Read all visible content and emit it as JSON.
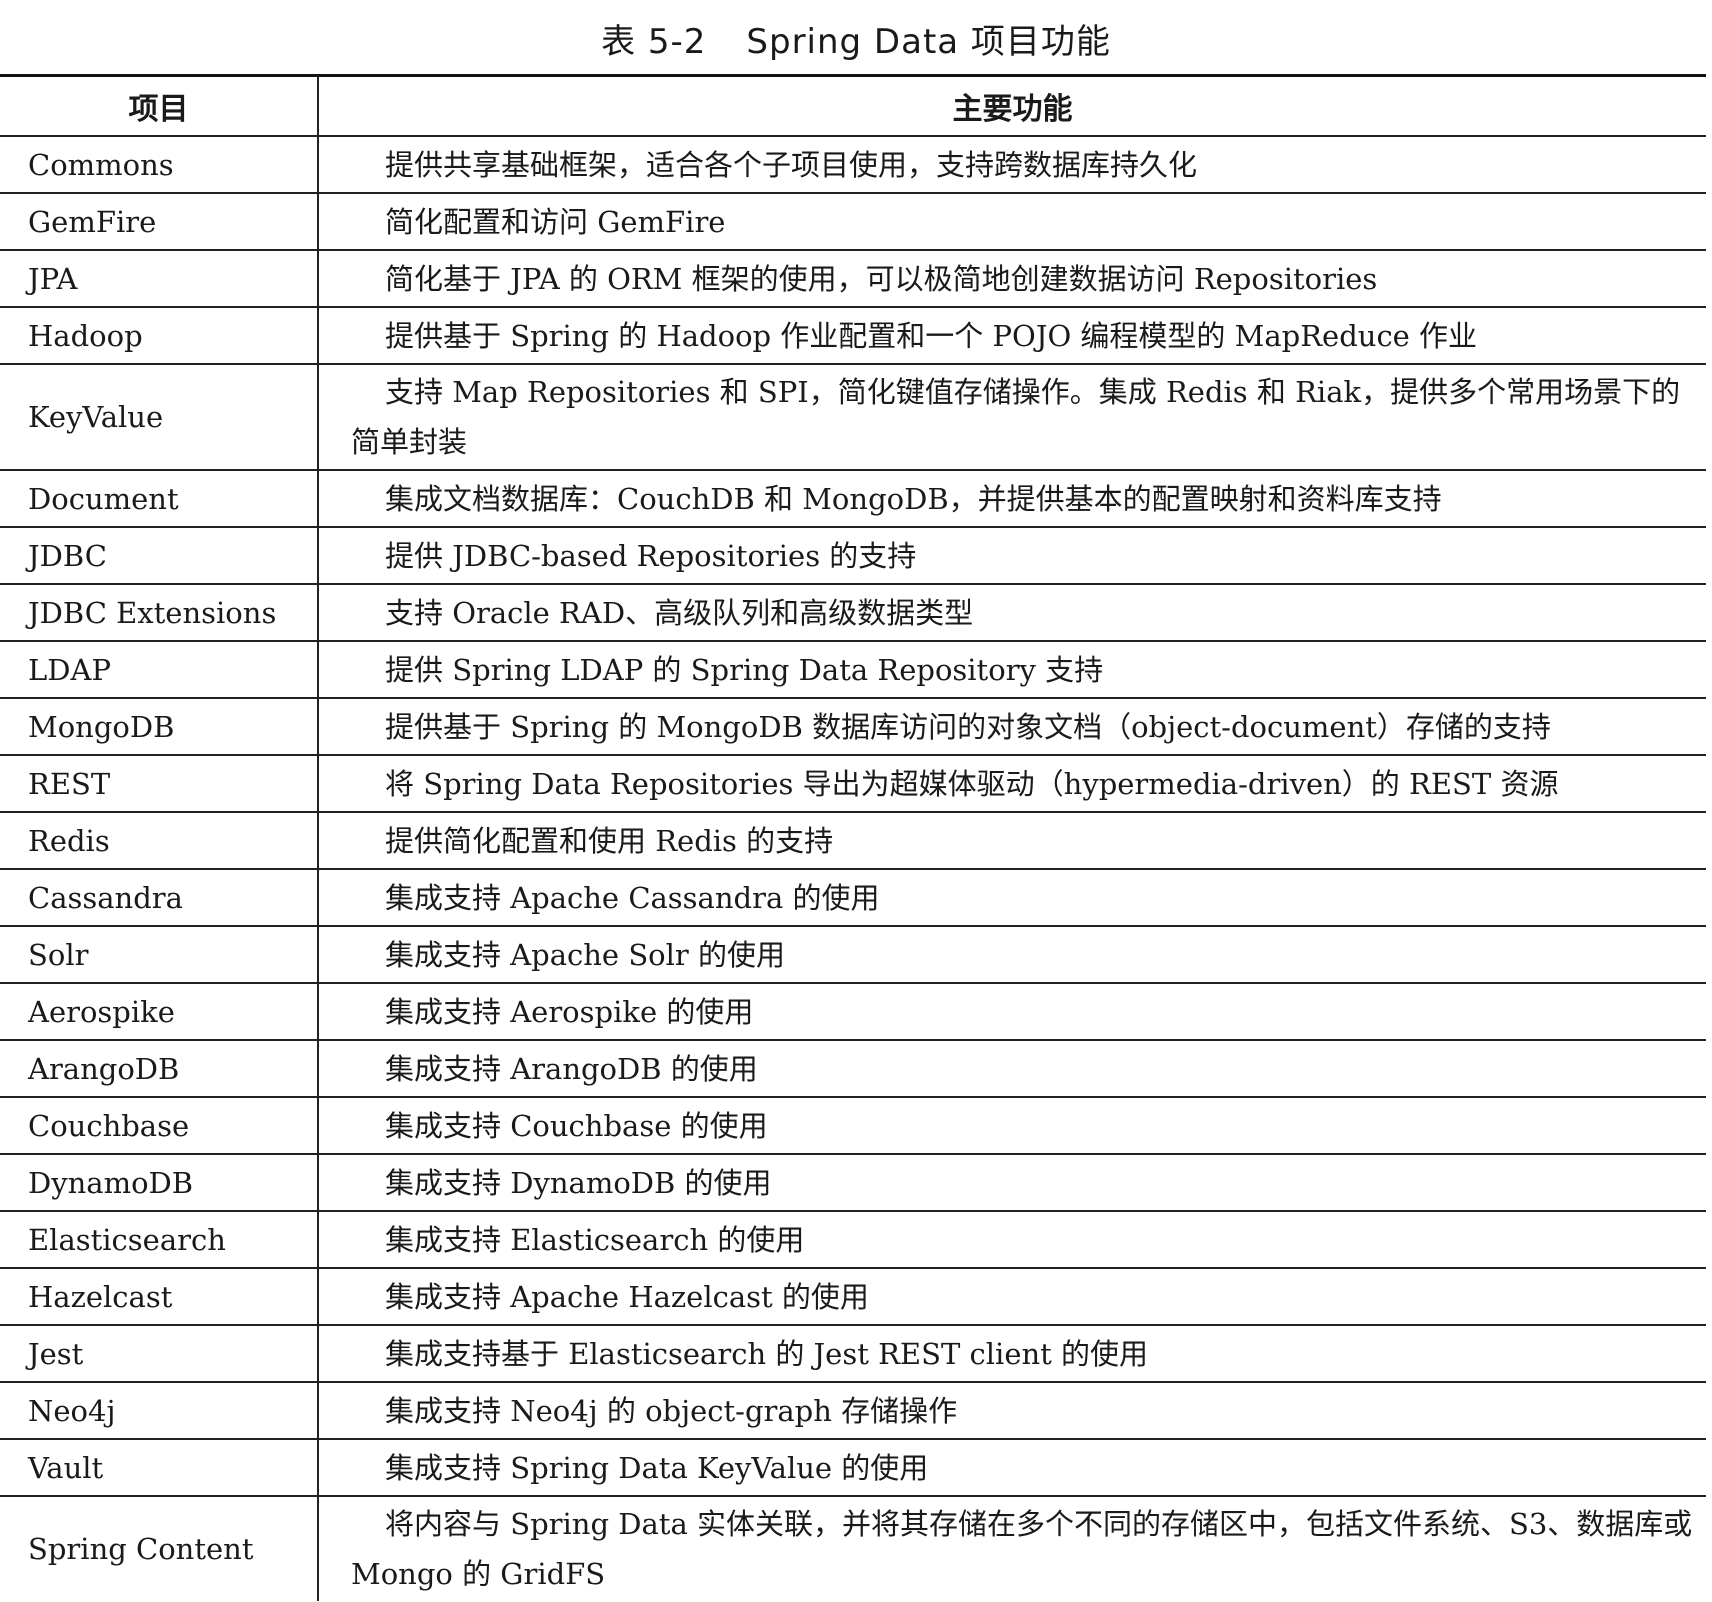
{
  "caption": {
    "number": "表 5-2",
    "title": "Spring Data 项目功能"
  },
  "table": {
    "headers": [
      "项目",
      "主要功能"
    ],
    "rows": [
      {
        "name": "Commons",
        "func": "提供共享基础框架，适合各个子项目使用，支持跨数据库持久化"
      },
      {
        "name": "GemFire",
        "func": "简化配置和访问 GemFire"
      },
      {
        "name": "JPA",
        "func": "简化基于 JPA 的 ORM 框架的使用，可以极简地创建数据访问 Repositories"
      },
      {
        "name": "Hadoop",
        "func": "提供基于 Spring 的 Hadoop 作业配置和一个 POJO 编程模型的 MapReduce 作业"
      },
      {
        "name": "KeyValue",
        "func": "支持 Map Repositories 和 SPI，简化键值存储操作。集成 Redis 和 Riak，提供多个常用场景下的简单封装"
      },
      {
        "name": "Document",
        "func": "集成文档数据库：CouchDB 和 MongoDB，并提供基本的配置映射和资料库支持"
      },
      {
        "name": "JDBC",
        "func": "提供 JDBC-based Repositories 的支持"
      },
      {
        "name": "JDBC Extensions",
        "func": "支持 Oracle RAD、高级队列和高级数据类型"
      },
      {
        "name": "LDAP",
        "func": "提供 Spring LDAP 的 Spring Data Repository 支持"
      },
      {
        "name": "MongoDB",
        "func": "提供基于 Spring 的 MongoDB 数据库访问的对象文档（object-document）存储的支持"
      },
      {
        "name": "REST",
        "func": "将 Spring Data Repositories 导出为超媒体驱动（hypermedia-driven）的 REST 资源"
      },
      {
        "name": "Redis",
        "func": "提供简化配置和使用 Redis 的支持"
      },
      {
        "name": "Cassandra",
        "func": "集成支持 Apache Cassandra 的使用"
      },
      {
        "name": "Solr",
        "func": "集成支持 Apache Solr 的使用"
      },
      {
        "name": "Aerospike",
        "func": "集成支持 Aerospike 的使用"
      },
      {
        "name": "ArangoDB",
        "func": "集成支持 ArangoDB 的使用"
      },
      {
        "name": "Couchbase",
        "func": "集成支持 Couchbase 的使用"
      },
      {
        "name": "DynamoDB",
        "func": "集成支持 DynamoDB 的使用"
      },
      {
        "name": "Elasticsearch",
        "func": "集成支持 Elasticsearch 的使用"
      },
      {
        "name": "Hazelcast",
        "func": "集成支持 Apache Hazelcast 的使用"
      },
      {
        "name": "Jest",
        "func": "集成支持基于 Elasticsearch 的 Jest REST client 的使用"
      },
      {
        "name": "Neo4j",
        "func": "集成支持 Neo4j 的 object-graph 存储操作"
      },
      {
        "name": "Vault",
        "func": "集成支持 Spring Data KeyValue 的使用"
      },
      {
        "name": "Spring Content",
        "func": "将内容与 Spring Data 实体关联，并将其存储在多个不同的存储区中，包括文件系统、S3、数据库或 Mongo 的 GridFS"
      }
    ]
  }
}
